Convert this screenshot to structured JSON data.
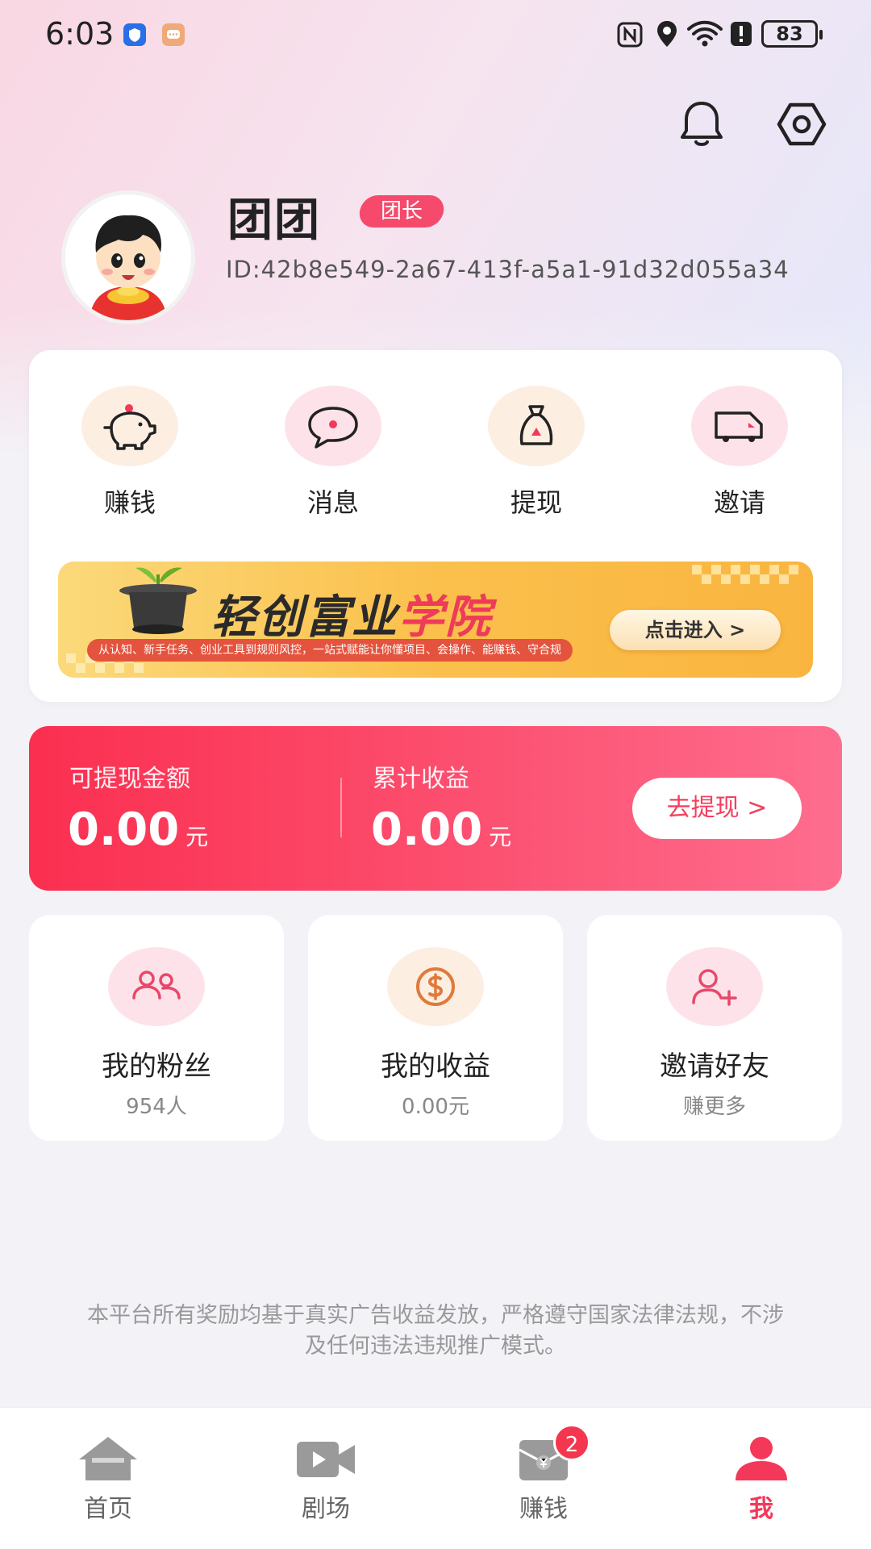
{
  "status_bar": {
    "time": "6:03",
    "battery": "83"
  },
  "profile": {
    "nickname": "团团",
    "role_badge": "团长",
    "user_id": "ID:42b8e549-2a67-413f-a5a1-91d32d055a34"
  },
  "quick_actions": [
    {
      "label": "赚钱",
      "icon": "piggy-bank-icon"
    },
    {
      "label": "消息",
      "icon": "chat-bubble-icon"
    },
    {
      "label": "提现",
      "icon": "money-bag-icon"
    },
    {
      "label": "邀请",
      "icon": "truck-icon"
    }
  ],
  "banner": {
    "title_main": "轻创富业",
    "title_accent": "学院",
    "subtitle": "从认知、新手任务、创业工具到规则风控，一站式赋能让你懂项目、会操作、能赚钱、守合规",
    "button": "点击进入 >"
  },
  "earnings": {
    "withdrawable_label": "可提现金额",
    "withdrawable_value": "0.00",
    "total_label": "累计收益",
    "total_value": "0.00",
    "unit": "元",
    "withdraw_button": "去提现 >"
  },
  "stats": [
    {
      "title": "我的粉丝",
      "sub": "954人",
      "icon": "fans-icon"
    },
    {
      "title": "我的收益",
      "sub": "0.00元",
      "icon": "coin-icon"
    },
    {
      "title": "邀请好友",
      "sub": "赚更多",
      "icon": "add-user-icon"
    }
  ],
  "disclaimer": "本平台所有奖励均基于真实广告收益发放，严格遵守国家法律法规，不涉及任何违法违规推广模式。",
  "tabs": [
    {
      "label": "首页",
      "icon": "home-icon"
    },
    {
      "label": "剧场",
      "icon": "video-icon"
    },
    {
      "label": "赚钱",
      "icon": "envelope-icon",
      "badge": "2"
    },
    {
      "label": "我",
      "icon": "user-icon",
      "active": true
    }
  ],
  "colors": {
    "accent": "#f3385a",
    "accent_light": "#fde3e9",
    "orange_light": "#fdeee2"
  }
}
